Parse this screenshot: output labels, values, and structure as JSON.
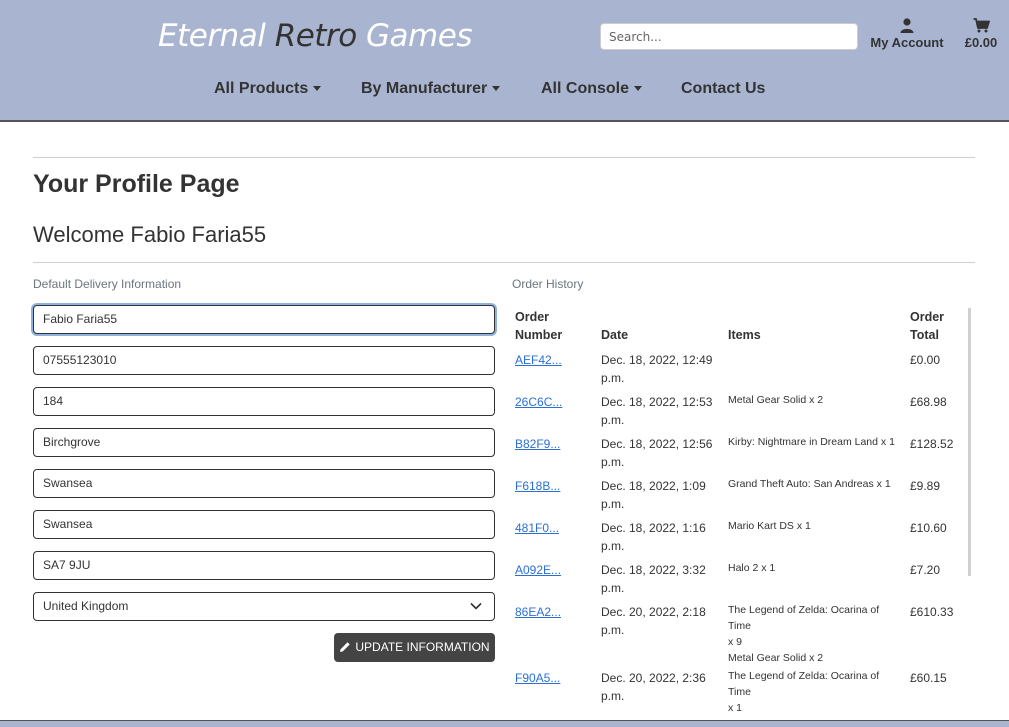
{
  "header": {
    "brand": [
      "Eternal",
      "Retro",
      "Games"
    ],
    "search_placeholder": "Search...",
    "account_label": "My Account",
    "cart_total": "£0.00",
    "nav": [
      "All Products",
      "By Manufacturer",
      "All Console",
      "Contact Us"
    ]
  },
  "profile": {
    "title": "Your Profile Page",
    "welcome": "Welcome Fabio Faria55",
    "delivery_label": "Default Delivery Information",
    "fields": [
      "Fabio Faria55",
      "07555123010",
      "184",
      "Birchgrove",
      "Swansea",
      "Swansea",
      "SA7 9JU"
    ],
    "country": "United Kingdom",
    "update_button": "UPDATE INFORMATION"
  },
  "orders": {
    "label": "Order History",
    "headers": {
      "number_line1": "Order",
      "number_line2": "Number",
      "date": "Date",
      "items": "Items",
      "total_line1": "Order",
      "total_line2": "Total"
    },
    "rows": [
      {
        "number": "AEF42...",
        "date1": "Dec. 18, 2022, 12:49",
        "date2": "p.m.",
        "items": [],
        "total": "£0.00"
      },
      {
        "number": "26C6C...",
        "date1": "Dec. 18, 2022, 12:53",
        "date2": "p.m.",
        "items": [
          "Metal Gear Solid x 2"
        ],
        "total": "£68.98"
      },
      {
        "number": "B82F9...",
        "date1": "Dec. 18, 2022, 12:56",
        "date2": "p.m.",
        "items": [
          "Kirby: Nightmare in Dream Land x 1"
        ],
        "total": "£128.52"
      },
      {
        "number": "F618B...",
        "date1": "Dec. 18, 2022, 1:09",
        "date2": "p.m.",
        "items": [
          "Grand Theft Auto: San Andreas x 1"
        ],
        "total": "£9.89"
      },
      {
        "number": "481F0...",
        "date1": "Dec. 18, 2022, 1:16",
        "date2": "p.m.",
        "items": [
          "Mario Kart DS x 1"
        ],
        "total": "£10.60"
      },
      {
        "number": "A092E...",
        "date1": "Dec. 18, 2022, 3:32",
        "date2": "p.m.",
        "items": [
          "Halo 2 x 1"
        ],
        "total": "£7.20"
      },
      {
        "number": "86EA2...",
        "date1": "Dec. 20, 2022, 2:18",
        "date2": "p.m.",
        "items": [
          "The Legend of Zelda: Ocarina of Time",
          "x 9",
          "Metal Gear Solid x 2"
        ],
        "total": "£610.33"
      },
      {
        "number": "F90A5...",
        "date1": "Dec. 20, 2022, 2:36",
        "date2": "p.m.",
        "items": [
          "The Legend of Zelda: Ocarina of Time",
          "x 1"
        ],
        "total": "£60.15"
      }
    ]
  }
}
